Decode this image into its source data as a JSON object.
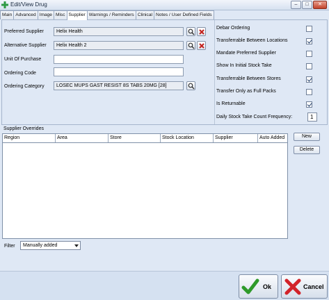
{
  "window": {
    "title": "Edit/View Drug",
    "minimize": "–",
    "restore": "□",
    "close": "✕"
  },
  "tabs": [
    {
      "label": "Main"
    },
    {
      "label": "Advanced"
    },
    {
      "label": "Image"
    },
    {
      "label": "Misc"
    },
    {
      "label": "Supplier",
      "active": true
    },
    {
      "label": "Warnings / Reminders"
    },
    {
      "label": "Clinical"
    },
    {
      "label": "Notes / User Defined Fields"
    }
  ],
  "left_form": {
    "preferred_supplier_label": "Preferred Supplier",
    "preferred_supplier_value": "Helix Health",
    "alternative_supplier_label": "Alternative Supplier",
    "alternative_supplier_value": "Helix Health 2",
    "unit_of_purchase_label": "Unit Of Purchase",
    "unit_of_purchase_value": "",
    "ordering_code_label": "Ordering Code",
    "ordering_code_value": "",
    "ordering_category_label": "Ordering Category",
    "ordering_category_value": "LOSEC MUPS  GAST RESIST  8S TABS 20MG [28]"
  },
  "options": [
    {
      "label": "Debar Ordering",
      "checked": false
    },
    {
      "label": "Transferrable Between Locations",
      "checked": true
    },
    {
      "label": "Mandate Preferred Supplier",
      "checked": false
    },
    {
      "label": "Show In Initial Stock Take",
      "checked": false
    },
    {
      "label": "Transferrable Between Stores",
      "checked": true
    },
    {
      "label": "Transfer Only as Full Packs",
      "checked": false
    },
    {
      "label": "Is Returnable",
      "checked": true
    }
  ],
  "stock_take": {
    "label": "Daily Stock Take Count Frequency:",
    "value": "1"
  },
  "overrides": {
    "title": "Supplier Overrides",
    "columns": [
      "Region",
      "Area",
      "Store",
      "Stock Location",
      "Supplier",
      "Auto Added"
    ],
    "rows": [],
    "new_button": "New",
    "delete_button": "Delete"
  },
  "filter": {
    "label": "Filter",
    "selected": "Manually added"
  },
  "footer": {
    "ok": "Ok",
    "cancel": "Cancel"
  },
  "colors": {
    "ok_green": "#2e9a2a",
    "cancel_red": "#d2232a",
    "background": "#dfe8f5"
  }
}
